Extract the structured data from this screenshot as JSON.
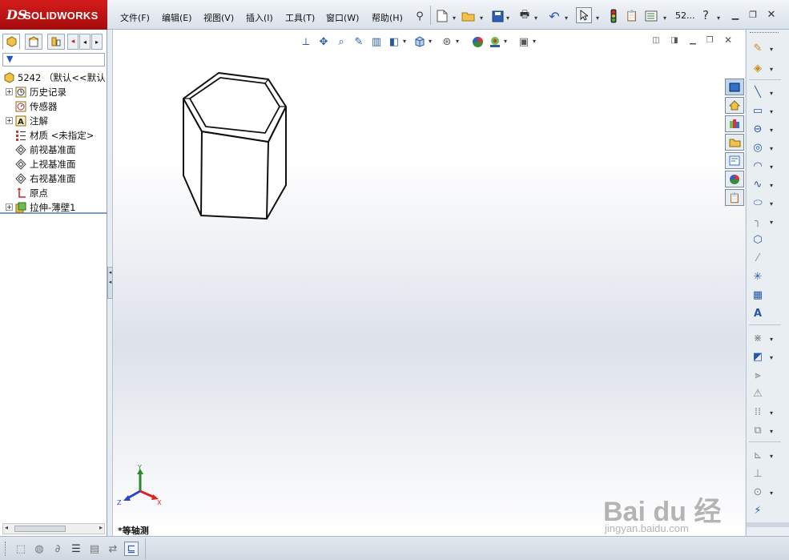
{
  "app": {
    "brand_ds": "DS",
    "brand_name": "SOLIDWORKS"
  },
  "menu": [
    {
      "label": "文件(F)"
    },
    {
      "label": "编辑(E)"
    },
    {
      "label": "视图(V)"
    },
    {
      "label": "插入(I)"
    },
    {
      "label": "工具(T)"
    },
    {
      "label": "窗口(W)"
    },
    {
      "label": "帮助(H)"
    }
  ],
  "toolbar": {
    "doc_name": "52...",
    "icons": [
      "pin-icon",
      "new-icon",
      "open-icon",
      "save-icon",
      "print-icon",
      "undo-icon",
      "select-icon",
      "rebuild-icon",
      "file-properties-icon",
      "options-icon",
      "help-icon"
    ]
  },
  "feature_tree": {
    "root": "5242 （默认<<默认",
    "nodes": [
      {
        "label": "历史记录",
        "icon": "history-icon",
        "expandable": true
      },
      {
        "label": "传感器",
        "icon": "sensor-icon",
        "expandable": false
      },
      {
        "label": "注解",
        "icon": "annotation-icon",
        "expandable": true
      },
      {
        "label": "材质 <未指定>",
        "icon": "material-icon",
        "expandable": false
      },
      {
        "label": "前视基准面",
        "icon": "plane-icon",
        "expandable": false
      },
      {
        "label": "上视基准面",
        "icon": "plane-icon",
        "expandable": false
      },
      {
        "label": "右视基准面",
        "icon": "plane-icon",
        "expandable": false
      },
      {
        "label": "原点",
        "icon": "origin-icon",
        "expandable": false
      },
      {
        "label": "拉伸-薄壁1",
        "icon": "extrude-icon",
        "expandable": true
      }
    ]
  },
  "viewport": {
    "view_name": "*等轴测",
    "triad": {
      "x": "X",
      "y": "Y",
      "z": "Z"
    },
    "watermark_big": "Bai  du 经验",
    "watermark_small": "jingyan.baidu.com"
  }
}
